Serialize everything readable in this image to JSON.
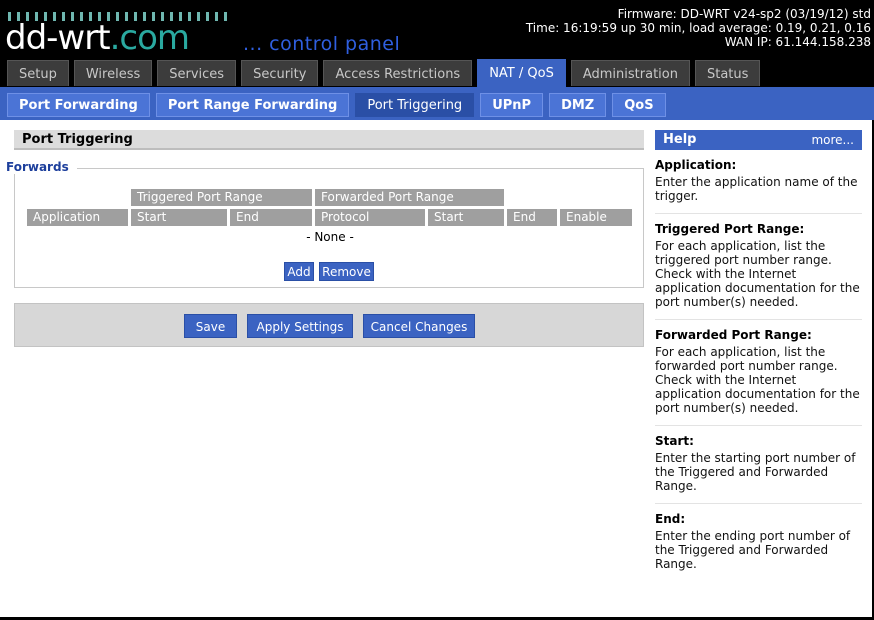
{
  "header": {
    "logo_main": "dd-wrt",
    "logo_dot": ".com",
    "subtitle": "... control panel",
    "firmware": "Firmware: DD-WRT v24-sp2 (03/19/12) std",
    "time": "Time: 16:19:59 up 30 min, load average: 0.19, 0.21, 0.16",
    "wan_ip": "WAN IP: 61.144.158.238"
  },
  "tabs": [
    {
      "label": "Setup"
    },
    {
      "label": "Wireless"
    },
    {
      "label": "Services"
    },
    {
      "label": "Security"
    },
    {
      "label": "Access Restrictions"
    },
    {
      "label": "NAT / QoS"
    },
    {
      "label": "Administration"
    },
    {
      "label": "Status"
    }
  ],
  "subnav": [
    {
      "label": "Port Forwarding"
    },
    {
      "label": "Port Range Forwarding"
    },
    {
      "label": "Port Triggering"
    },
    {
      "label": "UPnP"
    },
    {
      "label": "DMZ"
    },
    {
      "label": "QoS"
    }
  ],
  "main": {
    "section_title": "Port Triggering",
    "legend": "Forwards",
    "groups": {
      "triggered": "Triggered Port Range",
      "forwarded": "Forwarded Port Range"
    },
    "columns": {
      "application": "Application",
      "trig_start": "Start",
      "trig_end": "End",
      "protocol": "Protocol",
      "fwd_start": "Start",
      "fwd_end": "End",
      "enable": "Enable"
    },
    "empty_text": "- None -",
    "add_label": "Add",
    "remove_label": "Remove",
    "save_label": "Save",
    "apply_label": "Apply Settings",
    "cancel_label": "Cancel Changes"
  },
  "help": {
    "title": "Help",
    "more": "more...",
    "items": [
      {
        "term": "Application:",
        "desc": "Enter the application name of the trigger."
      },
      {
        "term": "Triggered Port Range:",
        "desc": "For each application, list the triggered port number range. Check with the Internet application documentation for the port number(s) needed."
      },
      {
        "term": "Forwarded Port Range:",
        "desc": "For each application, list the forwarded port number range. Check with the Internet application documentation for the port number(s) needed."
      },
      {
        "term": "Start:",
        "desc": "Enter the starting port number of the Triggered and Forwarded Range."
      },
      {
        "term": "End:",
        "desc": "Enter the ending port number of the Triggered and Forwarded Range."
      }
    ]
  },
  "colors": {
    "accent": "#3b63c2",
    "header_bg": "#000000",
    "table_header": "#9f9f9f"
  }
}
